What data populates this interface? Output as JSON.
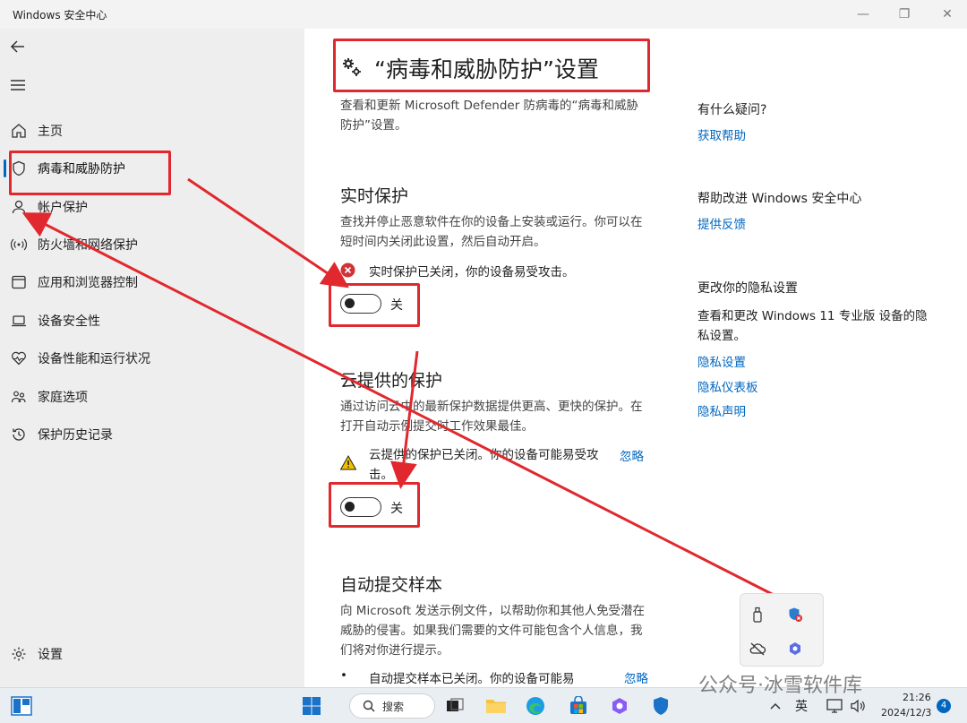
{
  "window": {
    "title": "Windows 安全中心",
    "minimize": "—",
    "maximize": "❐",
    "close": "✕"
  },
  "sidebar": {
    "items": [
      {
        "label": "主页",
        "icon": "home-icon"
      },
      {
        "label": "病毒和威胁防护",
        "icon": "shield-icon",
        "active": true
      },
      {
        "label": "帐户保护",
        "icon": "person-icon"
      },
      {
        "label": "防火墙和网络保护",
        "icon": "wifi-icon"
      },
      {
        "label": "应用和浏览器控制",
        "icon": "app-window-icon"
      },
      {
        "label": "设备安全性",
        "icon": "laptop-icon"
      },
      {
        "label": "设备性能和运行状况",
        "icon": "heart-pulse-icon"
      },
      {
        "label": "家庭选项",
        "icon": "family-icon"
      },
      {
        "label": "保护历史记录",
        "icon": "history-icon"
      }
    ],
    "settings_label": "设置"
  },
  "main": {
    "page_title": "“病毒和威胁防护”设置",
    "page_desc": "查看和更新 Microsoft Defender 防病毒的“病毒和威胁防护”设置。",
    "realtime": {
      "title": "实时保护",
      "desc": "查找并停止恶意软件在你的设备上安装或运行。你可以在短时间内关闭此设置，然后自动开启。",
      "status": "实时保护已关闭，你的设备易受攻击。",
      "toggle_label": "关"
    },
    "cloud": {
      "title": "云提供的保护",
      "desc": "通过访问云中的最新保护数据提供更高、更快的保护。在打开自动示例提交时工作效果最佳。",
      "status": "云提供的保护已关闭。你的设备可能易受攻击。",
      "dismiss": "忽略",
      "toggle_label": "关"
    },
    "sample": {
      "title": "自动提交样本",
      "desc": "向 Microsoft 发送示例文件，以帮助你和其他人免受潜在威胁的侵害。如果我们需要的文件可能包含个人信息，我们将对你进行提示。",
      "status": "自动提交样本已关闭。你的设备可能易",
      "dismiss": "忽略"
    }
  },
  "right": {
    "help_title": "有什么疑问?",
    "help_link": "获取帮助",
    "improve_title": "帮助改进 Windows 安全中心",
    "improve_link": "提供反馈",
    "privacy_title": "更改你的隐私设置",
    "privacy_desc": "查看和更改 Windows 11 专业版 设备的隐私设置。",
    "privacy_links": [
      "隐私设置",
      "隐私仪表板",
      "隐私声明"
    ]
  },
  "taskbar": {
    "search_label": "搜索",
    "ime": "英",
    "time": "21:26",
    "date": "2024/12/3",
    "notifications": "4"
  },
  "watermark": "公众号·冰雪软件库",
  "colors": {
    "accent": "#0067c0",
    "annotation_red": "#e0282e",
    "error_red": "#d13438",
    "warning_yellow": "#f0c000"
  }
}
